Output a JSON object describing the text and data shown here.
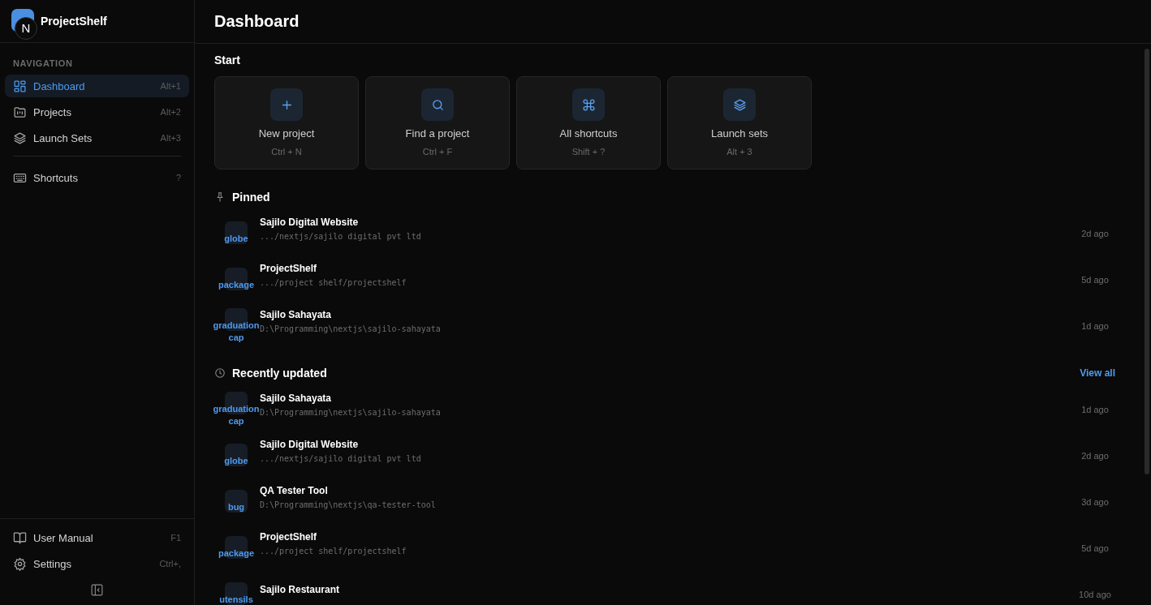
{
  "app": {
    "name": "ProjectShelf",
    "dev_badge": "N"
  },
  "sidebar": {
    "section_label": "NAVIGATION",
    "items": [
      {
        "kind": "dashboard",
        "label": "Dashboard",
        "shortcut": "Alt+1",
        "selected": true
      },
      {
        "kind": "projects",
        "label": "Projects",
        "shortcut": "Alt+2",
        "selected": false
      },
      {
        "kind": "layers",
        "label": "Launch Sets",
        "shortcut": "Alt+3",
        "selected": false
      },
      {
        "kind": "keyboard",
        "label": "Shortcuts",
        "shortcut": "?",
        "selected": false
      }
    ],
    "footer_items": [
      {
        "kind": "book",
        "label": "User Manual",
        "shortcut": "F1"
      },
      {
        "kind": "gear",
        "label": "Settings",
        "shortcut": "Ctrl+,"
      }
    ]
  },
  "header": {
    "title": "Dashboard"
  },
  "start": {
    "title": "Start",
    "cards": [
      {
        "kind": "plus",
        "label": "New project",
        "shortcut": "Ctrl + N"
      },
      {
        "kind": "search",
        "label": "Find a project",
        "shortcut": "Ctrl + F"
      },
      {
        "kind": "command",
        "label": "All shortcuts",
        "shortcut": "Shift + ?"
      },
      {
        "kind": "layers",
        "label": "Launch sets",
        "shortcut": "Alt + 3"
      }
    ]
  },
  "pinned": {
    "title": "Pinned",
    "rows": [
      {
        "icon_text": "globe",
        "name": "Sajilo Digital Website",
        "path": ".../nextjs/sajilo digital pvt ltd",
        "time": "2d ago"
      },
      {
        "icon_text": "package",
        "name": "ProjectShelf",
        "path": ".../project shelf/projectshelf",
        "time": "5d ago"
      },
      {
        "icon_text": "graduation cap",
        "name": "Sajilo Sahayata",
        "path": "D:\\Programming\\nextjs\\sajilo-sahayata",
        "time": "1d ago"
      }
    ]
  },
  "recent": {
    "title": "Recently updated",
    "link": "View all",
    "rows": [
      {
        "icon_text": "graduation cap",
        "name": "Sajilo Sahayata",
        "path": "D:\\Programming\\nextjs\\sajilo-sahayata",
        "time": "1d ago"
      },
      {
        "icon_text": "globe",
        "name": "Sajilo Digital Website",
        "path": ".../nextjs/sajilo digital pvt ltd",
        "time": "2d ago"
      },
      {
        "icon_text": "bug",
        "name": "QA Tester Tool",
        "path": "D:\\Programming\\nextjs\\qa-tester-tool",
        "time": "3d ago"
      },
      {
        "icon_text": "package",
        "name": "ProjectShelf",
        "path": ".../project shelf/projectshelf",
        "time": "5d ago"
      },
      {
        "icon_text": "utensils",
        "name": "Sajilo Restaurant",
        "time": "10d ago"
      }
    ]
  }
}
